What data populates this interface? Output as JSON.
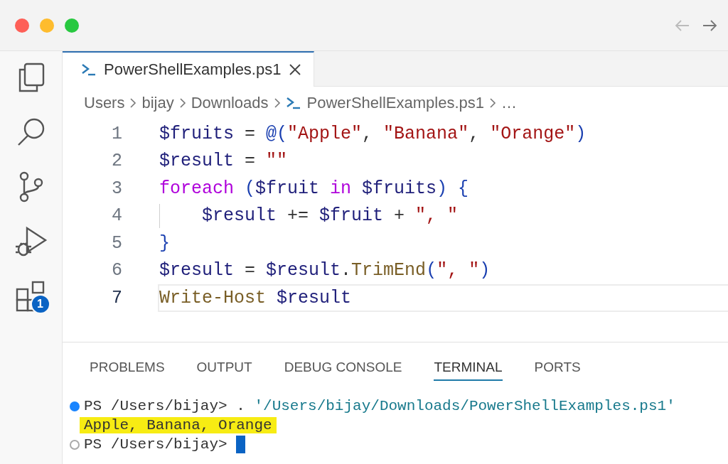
{
  "title_bar": {
    "nav": [
      {
        "kind": "back",
        "disabled": true
      },
      {
        "kind": "forward",
        "disabled": false
      }
    ]
  },
  "activity_bar": [
    {
      "kind": "files"
    },
    {
      "kind": "search"
    },
    {
      "kind": "source-control"
    },
    {
      "kind": "run-debug"
    },
    {
      "kind": "extensions",
      "badge": "1"
    }
  ],
  "tabs": [
    {
      "label": "PowerShellExamples.ps1",
      "selected": true
    }
  ],
  "breadcrumb": [
    {
      "label": "Users",
      "kind": "folder"
    },
    {
      "label": "bijay",
      "kind": "folder"
    },
    {
      "label": "Downloads",
      "kind": "folder"
    },
    {
      "label": "PowerShellExamples.ps1",
      "kind": "file"
    },
    {
      "label": "…",
      "kind": "more"
    }
  ],
  "code": [
    {
      "number": "1",
      "current": false,
      "indent_guide": false,
      "tokens": [
        {
          "text": "$fruits",
          "kind": "variable"
        },
        {
          "text": " = ",
          "kind": "operator"
        },
        {
          "text": "@(",
          "kind": "bracket"
        },
        {
          "text": "\"Apple\"",
          "kind": "string"
        },
        {
          "text": ", ",
          "kind": "operator"
        },
        {
          "text": "\"Banana\"",
          "kind": "string"
        },
        {
          "text": ", ",
          "kind": "operator"
        },
        {
          "text": "\"Orange\"",
          "kind": "string"
        },
        {
          "text": ")",
          "kind": "bracket"
        }
      ]
    },
    {
      "number": "2",
      "current": false,
      "indent_guide": false,
      "tokens": [
        {
          "text": "$result",
          "kind": "variable"
        },
        {
          "text": " = ",
          "kind": "operator"
        },
        {
          "text": "\"\"",
          "kind": "string"
        }
      ]
    },
    {
      "number": "3",
      "current": false,
      "indent_guide": false,
      "tokens": [
        {
          "text": "foreach",
          "kind": "keyword"
        },
        {
          "text": " (",
          "kind": "bracket"
        },
        {
          "text": "$fruit",
          "kind": "variable"
        },
        {
          "text": " in ",
          "kind": "keyword"
        },
        {
          "text": "$fruits",
          "kind": "variable"
        },
        {
          "text": ") {",
          "kind": "bracket"
        }
      ]
    },
    {
      "number": "4",
      "current": false,
      "indent_guide": true,
      "tokens": [
        {
          "text": "    $result",
          "kind": "variable"
        },
        {
          "text": " += ",
          "kind": "operator"
        },
        {
          "text": "$fruit",
          "kind": "variable"
        },
        {
          "text": " + ",
          "kind": "operator"
        },
        {
          "text": "\", \"",
          "kind": "string"
        }
      ]
    },
    {
      "number": "5",
      "current": false,
      "indent_guide": false,
      "tokens": [
        {
          "text": "}",
          "kind": "bracket"
        }
      ]
    },
    {
      "number": "6",
      "current": false,
      "indent_guide": false,
      "tokens": [
        {
          "text": "$result",
          "kind": "variable"
        },
        {
          "text": " = ",
          "kind": "operator"
        },
        {
          "text": "$result",
          "kind": "variable"
        },
        {
          "text": ".",
          "kind": "operator"
        },
        {
          "text": "TrimEnd",
          "kind": "function"
        },
        {
          "text": "(",
          "kind": "bracket"
        },
        {
          "text": "\", \"",
          "kind": "string"
        },
        {
          "text": ")",
          "kind": "bracket"
        }
      ]
    },
    {
      "number": "7",
      "current": true,
      "indent_guide": false,
      "tokens": [
        {
          "text": "Write-Host",
          "kind": "function"
        },
        {
          "text": " $result",
          "kind": "variable"
        }
      ]
    }
  ],
  "panel_tabs": [
    {
      "label": "PROBLEMS",
      "selected": false
    },
    {
      "label": "OUTPUT",
      "selected": false
    },
    {
      "label": "DEBUG CONSOLE",
      "selected": false
    },
    {
      "label": "TERMINAL",
      "selected": true
    },
    {
      "label": "PORTS",
      "selected": false
    }
  ],
  "terminal": [
    {
      "dot": true,
      "dot_filled": true,
      "highlighted": false,
      "cursor": false,
      "tokens": [
        {
          "text": "PS /Users/bijay> . ",
          "kind": "plain"
        },
        {
          "text": "'/Users/bijay/Downloads/PowerShellExamples.ps1'",
          "kind": "string"
        }
      ]
    },
    {
      "dot": false,
      "highlighted": true,
      "cursor": false,
      "tokens": [
        {
          "text": "Apple, Banana, Orange",
          "kind": "plain"
        }
      ]
    },
    {
      "dot": true,
      "dot_filled": false,
      "highlighted": false,
      "cursor": true,
      "tokens": [
        {
          "text": "PS /Users/bijay> ",
          "kind": "plain"
        }
      ]
    }
  ]
}
